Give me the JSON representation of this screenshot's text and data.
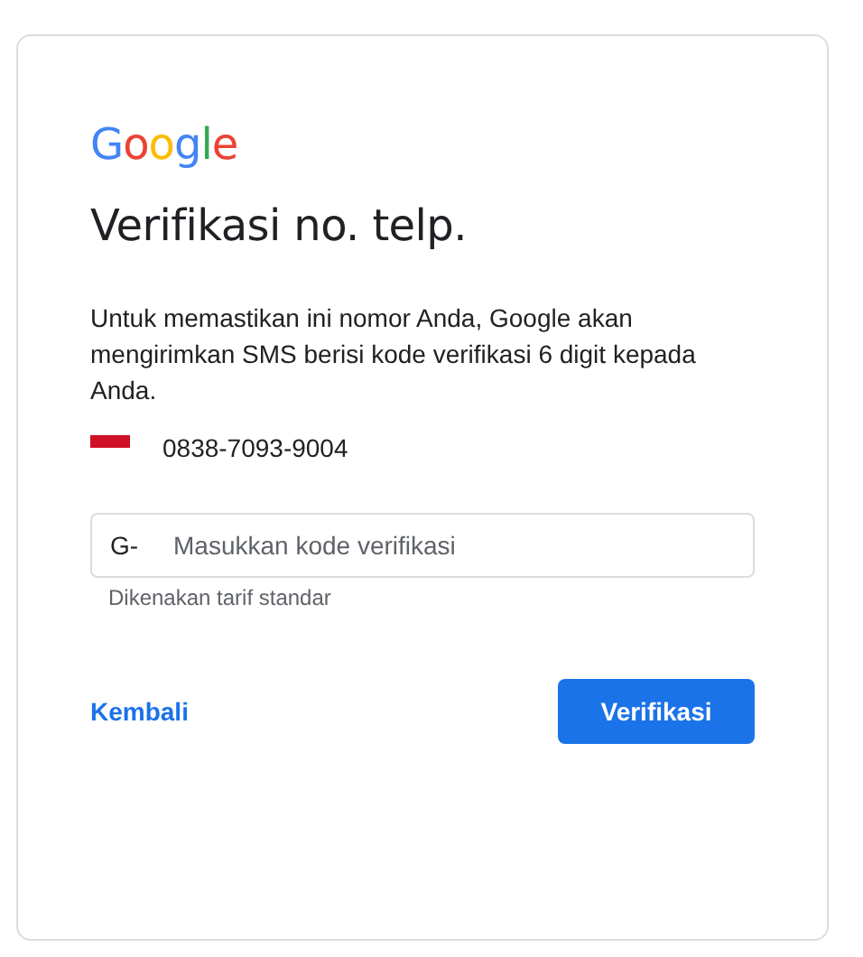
{
  "logo": "Google",
  "title": "Verifikasi no. telp.",
  "description": "Untuk memastikan ini nomor Anda, Google akan mengirimkan SMS berisi kode verifikasi 6 digit kepada Anda.",
  "phone": {
    "number": "0838-7093-9004"
  },
  "code_field": {
    "prefix": "G-",
    "placeholder": "Masukkan kode verifikasi",
    "helper": "Dikenakan tarif standar"
  },
  "back_link": "Kembali",
  "submit_button": "Verifikasi"
}
